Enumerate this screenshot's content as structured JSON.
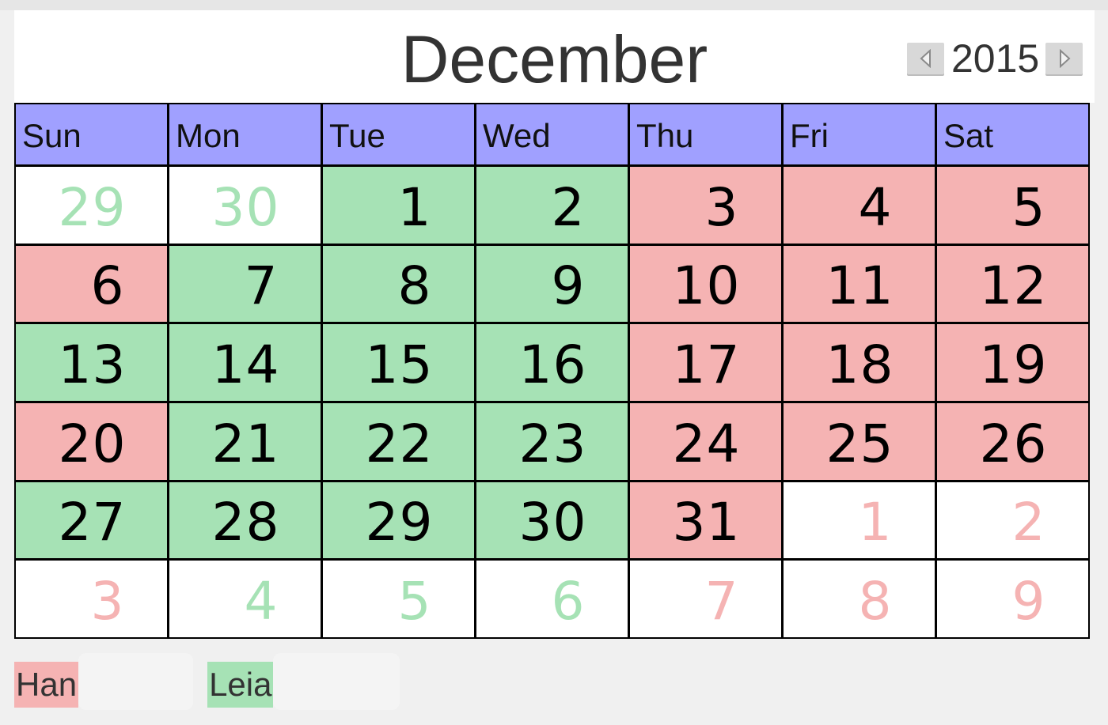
{
  "header": {
    "month": "December",
    "year": "2015",
    "prev_year_icon": "left-triangle-icon",
    "next_year_icon": "right-triangle-icon"
  },
  "weekdays": [
    "Sun",
    "Mon",
    "Tue",
    "Wed",
    "Thu",
    "Fri",
    "Sat"
  ],
  "colors": {
    "header_bg": "#a0a0ff",
    "han": "#f5b3b3",
    "leia": "#a6e2b5"
  },
  "weeks": [
    [
      {
        "day": "29",
        "owner": "leia",
        "in_month": false
      },
      {
        "day": "30",
        "owner": "leia",
        "in_month": false
      },
      {
        "day": "1",
        "owner": "leia",
        "in_month": true
      },
      {
        "day": "2",
        "owner": "leia",
        "in_month": true
      },
      {
        "day": "3",
        "owner": "han",
        "in_month": true
      },
      {
        "day": "4",
        "owner": "han",
        "in_month": true
      },
      {
        "day": "5",
        "owner": "han",
        "in_month": true
      }
    ],
    [
      {
        "day": "6",
        "owner": "han",
        "in_month": true
      },
      {
        "day": "7",
        "owner": "leia",
        "in_month": true
      },
      {
        "day": "8",
        "owner": "leia",
        "in_month": true
      },
      {
        "day": "9",
        "owner": "leia",
        "in_month": true
      },
      {
        "day": "10",
        "owner": "han",
        "in_month": true
      },
      {
        "day": "11",
        "owner": "han",
        "in_month": true
      },
      {
        "day": "12",
        "owner": "han",
        "in_month": true
      }
    ],
    [
      {
        "day": "13",
        "owner": "leia",
        "in_month": true
      },
      {
        "day": "14",
        "owner": "leia",
        "in_month": true
      },
      {
        "day": "15",
        "owner": "leia",
        "in_month": true
      },
      {
        "day": "16",
        "owner": "leia",
        "in_month": true
      },
      {
        "day": "17",
        "owner": "han",
        "in_month": true
      },
      {
        "day": "18",
        "owner": "han",
        "in_month": true
      },
      {
        "day": "19",
        "owner": "han",
        "in_month": true
      }
    ],
    [
      {
        "day": "20",
        "owner": "han",
        "in_month": true
      },
      {
        "day": "21",
        "owner": "leia",
        "in_month": true
      },
      {
        "day": "22",
        "owner": "leia",
        "in_month": true
      },
      {
        "day": "23",
        "owner": "leia",
        "in_month": true
      },
      {
        "day": "24",
        "owner": "han",
        "in_month": true
      },
      {
        "day": "25",
        "owner": "han",
        "in_month": true
      },
      {
        "day": "26",
        "owner": "han",
        "in_month": true
      }
    ],
    [
      {
        "day": "27",
        "owner": "leia",
        "in_month": true
      },
      {
        "day": "28",
        "owner": "leia",
        "in_month": true
      },
      {
        "day": "29",
        "owner": "leia",
        "in_month": true
      },
      {
        "day": "30",
        "owner": "leia",
        "in_month": true
      },
      {
        "day": "31",
        "owner": "han",
        "in_month": true
      },
      {
        "day": "1",
        "owner": "han",
        "in_month": false
      },
      {
        "day": "2",
        "owner": "han",
        "in_month": false
      }
    ],
    [
      {
        "day": "3",
        "owner": "han",
        "in_month": false
      },
      {
        "day": "4",
        "owner": "leia",
        "in_month": false
      },
      {
        "day": "5",
        "owner": "leia",
        "in_month": false
      },
      {
        "day": "6",
        "owner": "leia",
        "in_month": false
      },
      {
        "day": "7",
        "owner": "han",
        "in_month": false
      },
      {
        "day": "8",
        "owner": "han",
        "in_month": false
      },
      {
        "day": "9",
        "owner": "han",
        "in_month": false
      }
    ]
  ],
  "legend": [
    {
      "label": "Han",
      "owner": "han",
      "value": ""
    },
    {
      "label": "Leia",
      "owner": "leia",
      "value": ""
    }
  ]
}
